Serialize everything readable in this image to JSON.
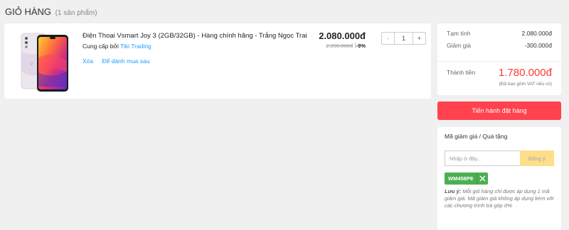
{
  "header": {
    "title": "GIỎ HÀNG",
    "count": "(1 sản phẩm)"
  },
  "cart": {
    "items": [
      {
        "image_icon": "smartphone-image",
        "name": "Điện Thoại Vsmart Joy 3 (2GB/32GB) - Hàng chính hãng - Trắng Ngọc Trai",
        "seller_prefix": "Cung cấp bởi",
        "seller_name": "Tiki Trading",
        "remove_label": "Xóa",
        "save_later_label": "Để dành mua sau",
        "price": "2.080.000đ",
        "original_price": "2.290.000đ",
        "separator": "|",
        "discount": "-9%",
        "qty_minus": "-",
        "quantity": "1",
        "qty_plus": "+"
      }
    ]
  },
  "summary": {
    "subtotal_label": "Tạm tính",
    "subtotal_value": "2.080.000đ",
    "discount_label": "Giảm giá",
    "discount_value": "-300.000đ",
    "total_label": "Thành tiền",
    "total_value": "1.780.000đ",
    "vat_note": "(Đã bao gồm VAT nếu có)"
  },
  "checkout": {
    "label": "Tiến hành đặt hàng"
  },
  "coupon": {
    "title": "Mã giảm giá / Quà tặng",
    "input_placeholder": "Nhập ở đây...",
    "apply_label": "Đồng ý",
    "applied_code": "WM458P8",
    "note_prefix": "Lưu ý:",
    "note_text": "Mỗi giỏ hàng chỉ được áp dụng 1 mã giảm giá. Mã giảm giá không áp dụng kèm với các chương trình trả góp 0%"
  },
  "colors": {
    "accent_red": "#ff424e",
    "total_red": "#fe3834",
    "link_blue": "#189eff",
    "coupon_green": "#4caf50",
    "apply_yellow": "#fdde8a"
  }
}
